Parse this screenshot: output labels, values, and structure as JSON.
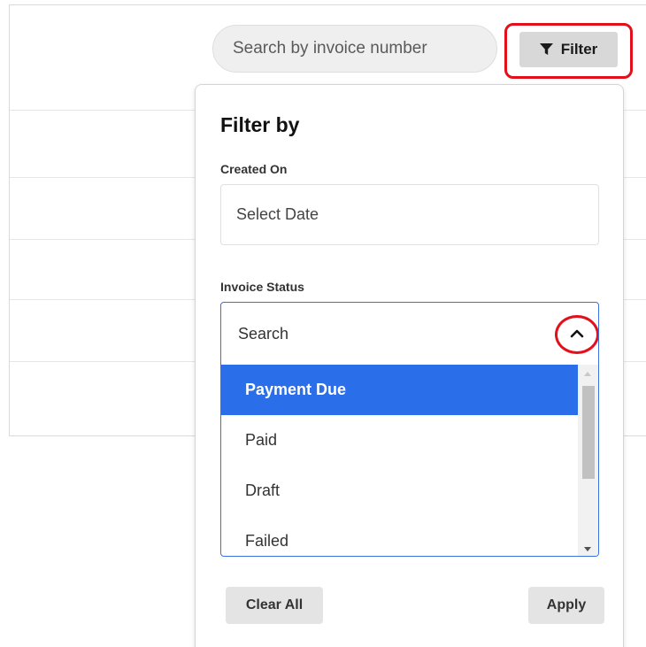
{
  "search": {
    "placeholder": "Search by invoice number"
  },
  "toolbar": {
    "filter_label": "Filter"
  },
  "filter_panel": {
    "title": "Filter by",
    "created_on": {
      "label": "Created On",
      "placeholder": "Select Date"
    },
    "invoice_status": {
      "label": "Invoice Status",
      "search_text": "Search",
      "options": [
        "Payment Due",
        "Paid",
        "Draft",
        "Failed"
      ],
      "highlighted": "Payment Due"
    },
    "clear_label": "Clear All",
    "apply_label": "Apply"
  },
  "colors": {
    "highlight_red": "#e3101b",
    "selected_option": "#2b6ee9",
    "select_border": "#3a6fe0"
  },
  "icons": {
    "filter": "funnel-icon",
    "collapse": "chevron-up-icon"
  }
}
